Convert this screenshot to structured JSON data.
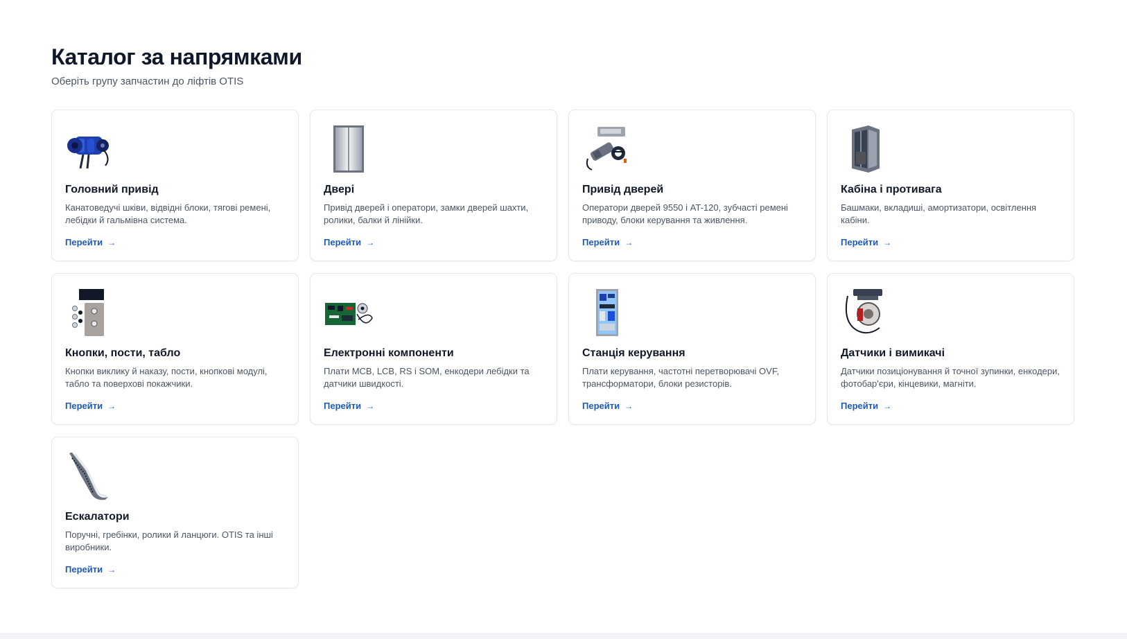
{
  "catalog": {
    "title": "Каталог за напрямками",
    "subtitle": "Оберіть групу запчастин до ліфтів OTIS",
    "link_label": "Перейти",
    "link_arrow": "→",
    "cards": [
      {
        "icon": "traction-machine-image",
        "title": "Головний привід",
        "description": "Канатоведучі шківи, відвідні блоки, тягові ремені, лебідки й гальмівна система."
      },
      {
        "icon": "elevator-door-image",
        "title": "Двері",
        "description": "Привід дверей і оператори, замки дверей шахти, ролики, балки й лінійки."
      },
      {
        "icon": "door-operator-image",
        "title": "Привід дверей",
        "description": "Оператори дверей 9550 і AT-120, зубчасті ремені приводу, блоки керування та живлення."
      },
      {
        "icon": "elevator-cabin-image",
        "title": "Кабіна і противага",
        "description": "Башмаки, вкладиші, амортизатори, освітлення кабіни."
      },
      {
        "icon": "buttons-panel-image",
        "title": "Кнопки, пости, табло",
        "description": "Кнопки виклику й наказу, пости, кнопкові модулі, табло та поверхові покажчики."
      },
      {
        "icon": "circuit-board-image",
        "title": "Електронні компоненти",
        "description": "Плати MCB, LCB, RS і SOM, енкодери лебідки та датчики швидкості."
      },
      {
        "icon": "control-cabinet-image",
        "title": "Станція керування",
        "description": "Плати керування, частотні перетворювачі OVF, трансформатори, блоки резисторів."
      },
      {
        "icon": "sensor-switch-image",
        "title": "Датчики і вимикачі",
        "description": "Датчики позиціонування й точної зупинки, енкодери, фотобар'єри, кінцевики, магніти."
      },
      {
        "icon": "escalator-image",
        "title": "Ескалатори",
        "description": "Поручні, гребінки, ролики й ланцюги. OTIS та інші виробники."
      }
    ]
  }
}
